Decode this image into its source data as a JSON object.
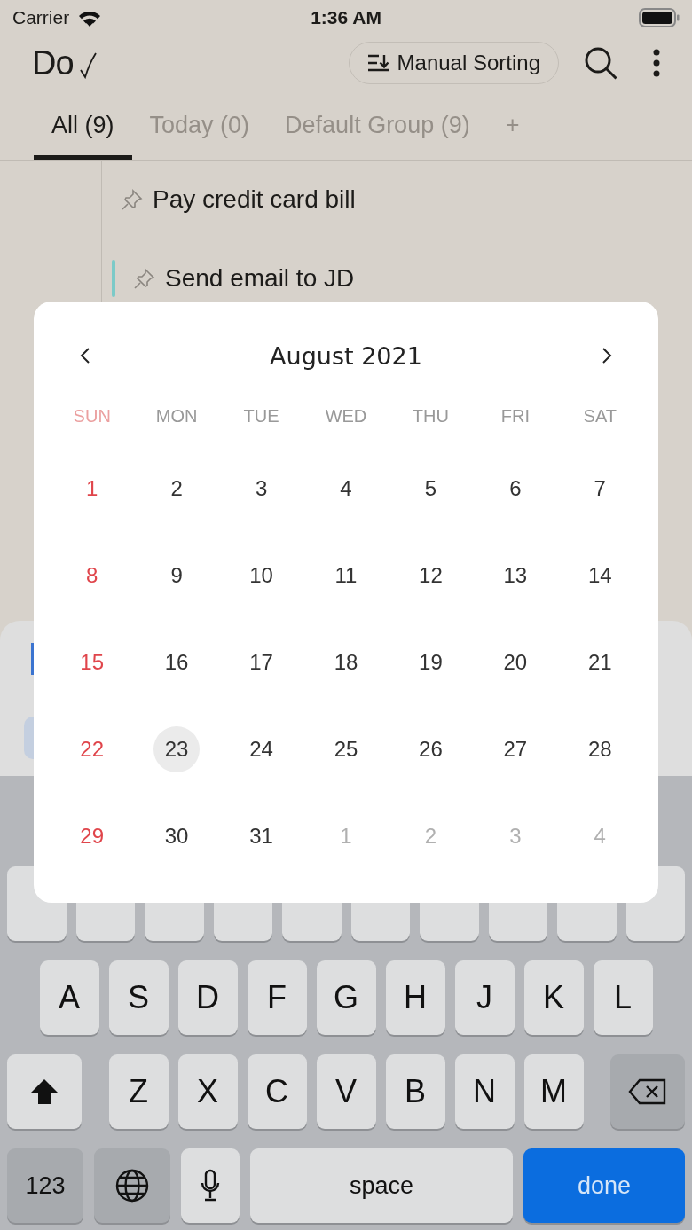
{
  "status_bar": {
    "carrier": "Carrier",
    "time": "1:36 AM"
  },
  "header": {
    "logo": "Do",
    "sort_button": "Manual Sorting"
  },
  "tabs": [
    {
      "label": "All (9)",
      "selected": true
    },
    {
      "label": "Today (0)",
      "selected": false
    },
    {
      "label": "Default Group (9)",
      "selected": false
    },
    {
      "label": "+",
      "selected": false
    }
  ],
  "tasks": [
    {
      "title": "Pay credit card bill"
    },
    {
      "title": "Send email to JD",
      "color": "#7ccac8"
    }
  ],
  "calendar": {
    "title": "August 2021",
    "weekdays": [
      {
        "label": "SUN",
        "weekend": true
      },
      {
        "label": "MON",
        "weekend": false
      },
      {
        "label": "TUE",
        "weekend": false
      },
      {
        "label": "WED",
        "weekend": false
      },
      {
        "label": "THU",
        "weekend": false
      },
      {
        "label": "FRI",
        "weekend": false
      },
      {
        "label": "SAT",
        "weekend": false
      }
    ],
    "days": [
      {
        "label": "1",
        "other_month": false,
        "selected": false
      },
      {
        "label": "2",
        "other_month": false,
        "selected": false
      },
      {
        "label": "3",
        "other_month": false,
        "selected": false
      },
      {
        "label": "4",
        "other_month": false,
        "selected": false
      },
      {
        "label": "5",
        "other_month": false,
        "selected": false
      },
      {
        "label": "6",
        "other_month": false,
        "selected": false
      },
      {
        "label": "7",
        "other_month": false,
        "selected": false
      },
      {
        "label": "8",
        "other_month": false,
        "selected": false
      },
      {
        "label": "9",
        "other_month": false,
        "selected": false
      },
      {
        "label": "10",
        "other_month": false,
        "selected": false
      },
      {
        "label": "11",
        "other_month": false,
        "selected": false
      },
      {
        "label": "12",
        "other_month": false,
        "selected": false
      },
      {
        "label": "13",
        "other_month": false,
        "selected": false
      },
      {
        "label": "14",
        "other_month": false,
        "selected": false
      },
      {
        "label": "15",
        "other_month": false,
        "selected": false
      },
      {
        "label": "16",
        "other_month": false,
        "selected": false
      },
      {
        "label": "17",
        "other_month": false,
        "selected": false
      },
      {
        "label": "18",
        "other_month": false,
        "selected": false
      },
      {
        "label": "19",
        "other_month": false,
        "selected": false
      },
      {
        "label": "20",
        "other_month": false,
        "selected": false
      },
      {
        "label": "21",
        "other_month": false,
        "selected": false
      },
      {
        "label": "22",
        "other_month": false,
        "selected": false
      },
      {
        "label": "23",
        "other_month": false,
        "selected": true
      },
      {
        "label": "24",
        "other_month": false,
        "selected": false
      },
      {
        "label": "25",
        "other_month": false,
        "selected": false
      },
      {
        "label": "26",
        "other_month": false,
        "selected": false
      },
      {
        "label": "27",
        "other_month": false,
        "selected": false
      },
      {
        "label": "28",
        "other_month": false,
        "selected": false
      },
      {
        "label": "29",
        "other_month": false,
        "selected": false
      },
      {
        "label": "30",
        "other_month": false,
        "selected": false
      },
      {
        "label": "31",
        "other_month": false,
        "selected": false
      },
      {
        "label": "1",
        "other_month": true,
        "selected": false
      },
      {
        "label": "2",
        "other_month": true,
        "selected": false
      },
      {
        "label": "3",
        "other_month": true,
        "selected": false
      },
      {
        "label": "4",
        "other_month": true,
        "selected": false
      }
    ]
  },
  "keyboard": {
    "home_row": [
      "A",
      "S",
      "D",
      "F",
      "G",
      "H",
      "J",
      "K",
      "L"
    ],
    "lower_row": [
      "Z",
      "X",
      "C",
      "V",
      "B",
      "N",
      "M"
    ],
    "bottom_row": [
      {
        "kind": "mode",
        "label": "123"
      },
      {
        "kind": "globe"
      },
      {
        "kind": "mic"
      },
      {
        "kind": "space",
        "label": "space"
      },
      {
        "kind": "done",
        "label": "done"
      }
    ]
  }
}
